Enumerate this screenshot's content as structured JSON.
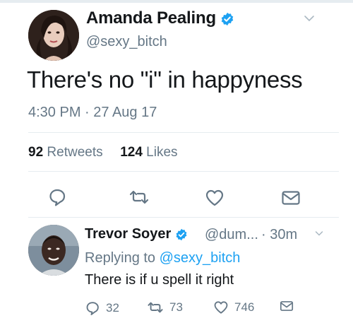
{
  "main_tweet": {
    "author_name": "Amanda Pealing",
    "handle": "@sexy_bitch",
    "text": "There's no \"i\" in happyness",
    "timestamp": "4:30 PM · 27 Aug 17",
    "retweets_count": "92",
    "retweets_label": "Retweets",
    "likes_count": "124",
    "likes_label": "Likes"
  },
  "reply": {
    "author_name": "Trevor Soyer",
    "handle": "@dum...",
    "time": "· 30m",
    "replying_prefix": "Replying to",
    "replying_handle": "@sexy_bitch",
    "text": "There is if u spell it right",
    "reply_count": "32",
    "retweet_count": "73",
    "like_count": "746"
  },
  "colors": {
    "verified_blue": "#1da1f2",
    "gray_text": "#657786",
    "divider": "#e6ecf0"
  },
  "icons": [
    "verified-badge-icon",
    "chevron-down-icon",
    "reply-icon",
    "retweet-icon",
    "like-icon",
    "direct-message-icon"
  ]
}
